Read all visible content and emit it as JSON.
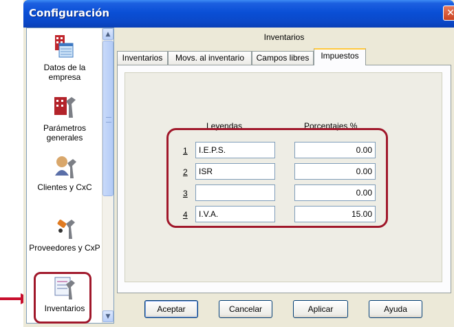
{
  "window": {
    "title": "Configuración",
    "close_glyph": "✕"
  },
  "nav": {
    "items": [
      {
        "label": "Datos de la empresa",
        "icon": "company-data-icon"
      },
      {
        "label": "Parámetros generales",
        "icon": "general-params-icon"
      },
      {
        "label": "Clientes y CxC",
        "icon": "clients-icon"
      },
      {
        "label": "Proveedores y CxP",
        "icon": "suppliers-icon"
      },
      {
        "label": "Inventarios",
        "icon": "inventory-icon",
        "selected": true
      }
    ]
  },
  "panel": {
    "header": "Inventarios",
    "tabs": [
      {
        "label": "Inventarios"
      },
      {
        "label": "Movs. al inventario"
      },
      {
        "label": "Campos libres"
      },
      {
        "label": "Impuestos",
        "active": true
      }
    ],
    "table": {
      "col_legend": "Leyendas",
      "col_percent": "Porcentajes %",
      "rows": [
        {
          "num": "1",
          "legend": "I.E.P.S.",
          "percent": "0.00"
        },
        {
          "num": "2",
          "legend": "ISR",
          "percent": "0.00"
        },
        {
          "num": "3",
          "legend": "",
          "percent": "0.00"
        },
        {
          "num": "4",
          "legend": "I.V.A.",
          "percent": "15.00"
        }
      ]
    }
  },
  "buttons": {
    "accept": "Aceptar",
    "cancel": "Cancelar",
    "apply": "Aplicar",
    "help": "Ayuda"
  },
  "colors": {
    "titlebar": "#0a4fd6",
    "highlight": "#a0172a",
    "tab_active_accent": "#ffc83c"
  }
}
